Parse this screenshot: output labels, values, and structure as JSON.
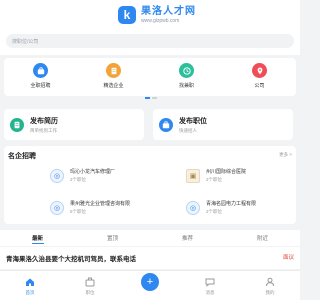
{
  "header": {
    "title": "果洛人才网",
    "url": "www.glzpwb.com"
  },
  "search": {
    "placeholder": "搜职位/公司"
  },
  "quick_nav": [
    {
      "label": "全职招聘",
      "icon": "briefcase-icon",
      "color": "#2f88f0"
    },
    {
      "label": "精选企业",
      "icon": "building-icon",
      "color": "#f2a33a"
    },
    {
      "label": "找兼职",
      "icon": "clock-icon",
      "color": "#2bbf9c"
    },
    {
      "label": "公司",
      "icon": "location-pin-icon",
      "color": "#ef4d57"
    }
  ],
  "post_cards": [
    {
      "title": "发布简历",
      "subtitle": "简单找到工作",
      "color": "#23b58e",
      "icon": "resume-icon"
    },
    {
      "title": "发布职位",
      "subtitle": "快速招人",
      "color": "#2f88f0",
      "icon": "job-icon"
    }
  ],
  "famous": {
    "title": "名企招聘",
    "more": "更多 >",
    "companies": [
      {
        "name": "玛沁小龙汽车修理厂",
        "count": "2个职位"
      },
      {
        "name": "州川国际综合医院",
        "count": "2个职位"
      },
      {
        "name": "果州雅光企业管理咨询有限",
        "count": "5个职位"
      },
      {
        "name": "青海名园电力工程有限",
        "count": "2个职位"
      }
    ]
  },
  "tabs": [
    {
      "label": "最新",
      "active": true
    },
    {
      "label": "置顶",
      "active": false
    },
    {
      "label": "推荐",
      "active": false
    },
    {
      "label": "附近",
      "active": false
    }
  ],
  "article": {
    "title": "青海果洛久治县要个大挖机司驾员，联系电话",
    "badge": "面议"
  },
  "bottom_nav": [
    {
      "label": "首页",
      "icon": "home-icon",
      "active": true
    },
    {
      "label": "职位",
      "icon": "briefcase-icon",
      "active": false
    },
    {
      "label": "",
      "icon": "plus-icon",
      "active": false
    },
    {
      "label": "消息",
      "icon": "message-icon",
      "active": false
    },
    {
      "label": "我的",
      "icon": "user-icon",
      "active": false
    }
  ]
}
